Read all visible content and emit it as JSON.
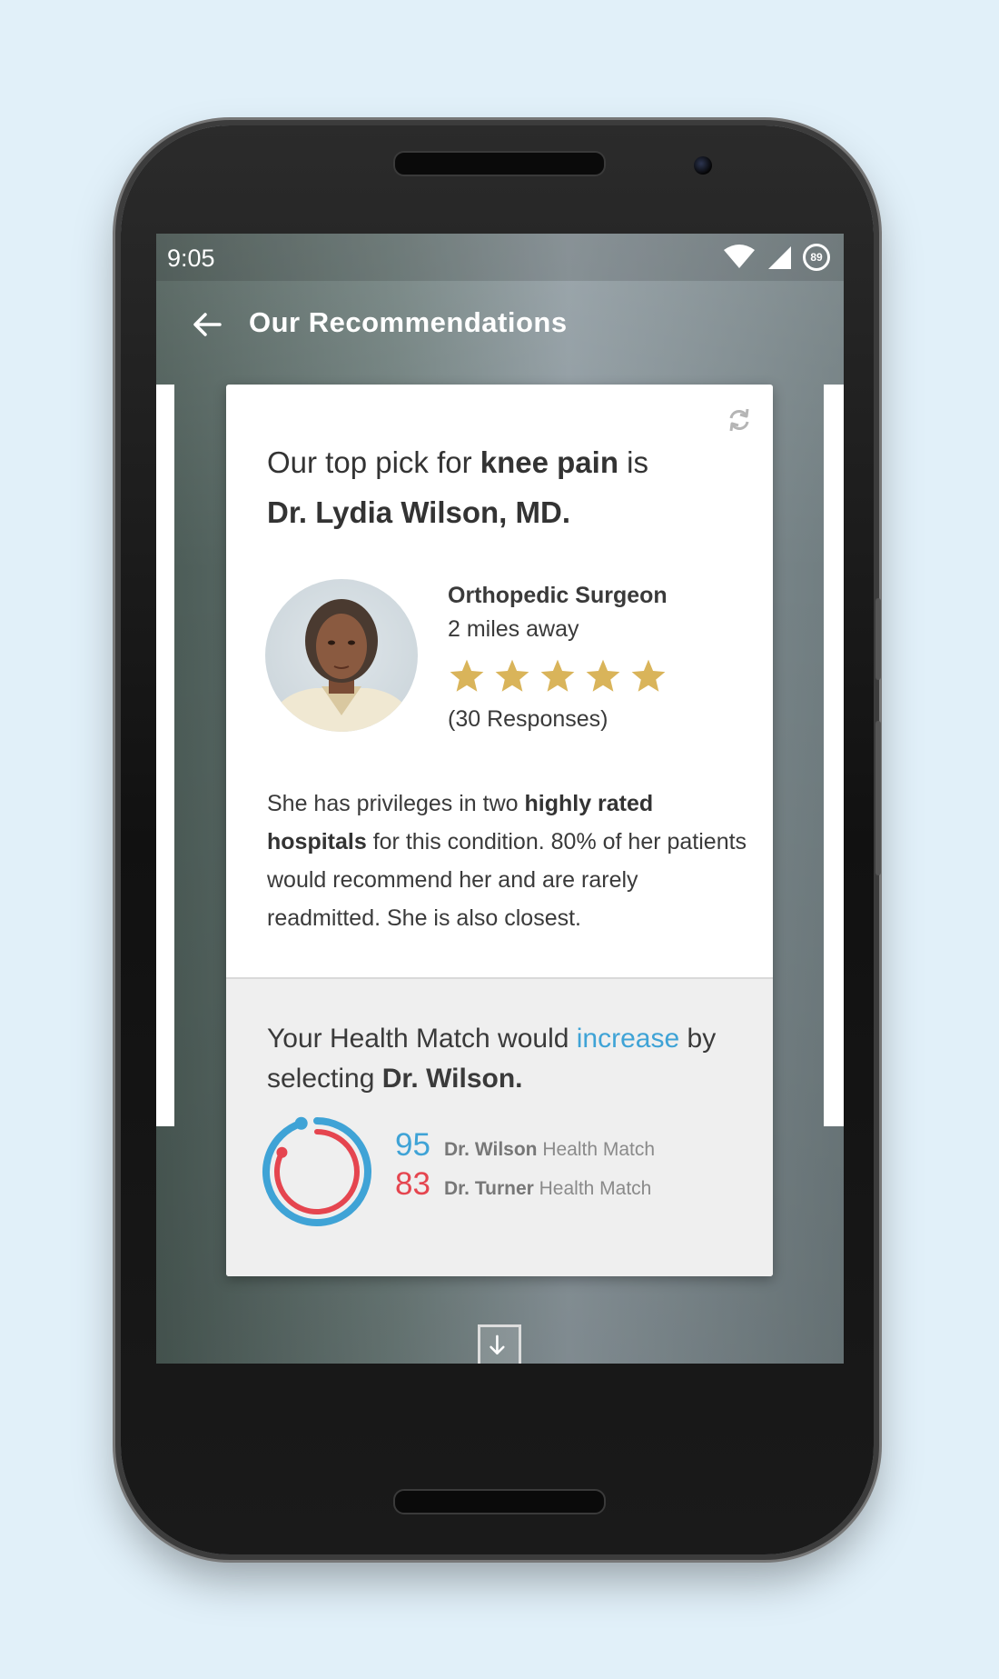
{
  "status_bar": {
    "time": "9:05",
    "battery_level": "89"
  },
  "app_bar": {
    "title": "Our Recommendations"
  },
  "card": {
    "headline": {
      "prefix": "Our top pick for ",
      "condition": "knee pain",
      "mid": " is",
      "doctor": "Dr. Lydia Wilson, MD."
    },
    "specialty": "Orthopedic Surgeon",
    "distance": "2 miles away",
    "rating": 5,
    "responses": "(30 Responses)",
    "description": {
      "p1": "She has privileges in two ",
      "b1": "highly rated hospitals",
      "p2": " for this condition. 80% of her patients would recommend her and are rarely readmitted. She is also closest."
    }
  },
  "health_match": {
    "text_prefix": "Your Health Match would ",
    "text_highlight": "increase",
    "text_suffix": " by selecting ",
    "text_doctor": "Dr. Wilson.",
    "scores": [
      {
        "value": "95",
        "name": "Dr. Wilson",
        "label": " Health Match",
        "color": "#3fa3d6",
        "fraction": 0.95
      },
      {
        "value": "83",
        "name": "Dr. Turner",
        "label": " Health Match",
        "color": "#e5454f",
        "fraction": 0.83
      }
    ]
  },
  "colors": {
    "accent_blue": "#3fa3d6",
    "accent_red": "#e5454f",
    "star_gold": "#d9b45a"
  }
}
